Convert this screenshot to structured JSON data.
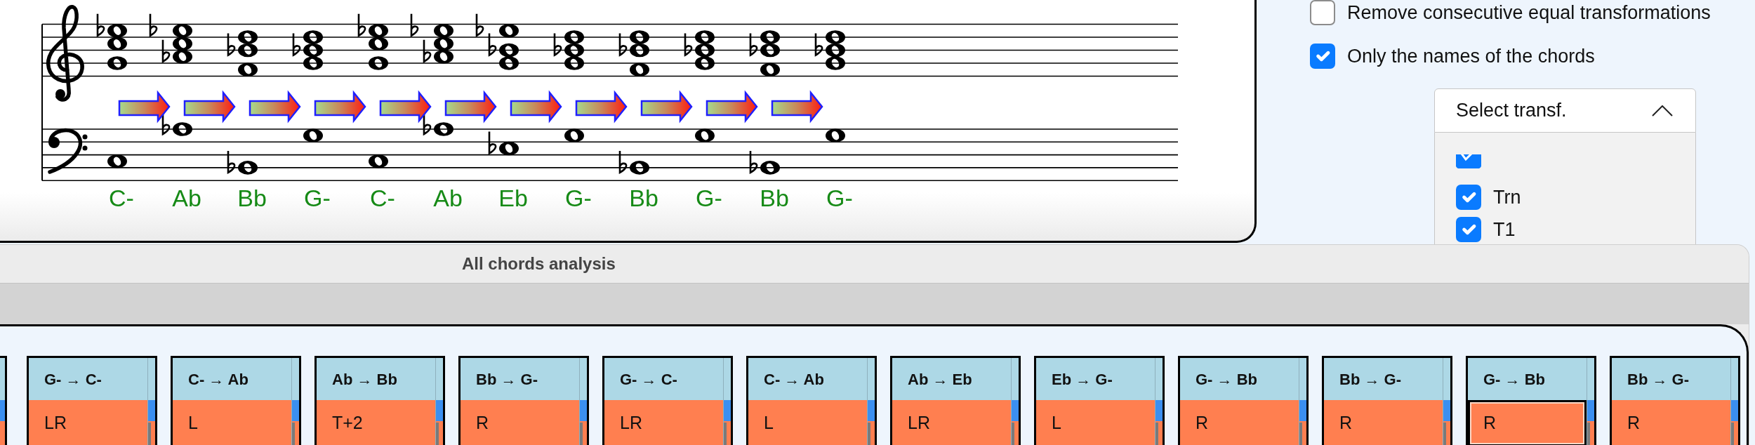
{
  "score": {
    "chords": [
      {
        "name": "C-"
      },
      {
        "name": "Ab"
      },
      {
        "name": "Bb"
      },
      {
        "name": "G-"
      },
      {
        "name": "C-"
      },
      {
        "name": "Ab"
      },
      {
        "name": "Eb"
      },
      {
        "name": "G-"
      },
      {
        "name": "Bb"
      },
      {
        "name": "G-"
      },
      {
        "name": "Bb"
      },
      {
        "name": "G-"
      }
    ]
  },
  "options": [
    {
      "label": "Remove consecutive equal transformations",
      "checked": false
    },
    {
      "label": "Only the names of the chords",
      "checked": true
    }
  ],
  "transform_select": {
    "label": "Select transf.",
    "expanded": true,
    "items": [
      {
        "checked": true
      },
      {
        "label": "Trn",
        "checked": true
      },
      {
        "label": "T1",
        "checked": true
      }
    ]
  },
  "analysis_window": {
    "title": "All chords analysis",
    "cards": [
      {
        "pair": "G- → C-",
        "transformation": "LR",
        "selected": false
      },
      {
        "pair": "C- → Ab",
        "transformation": "L",
        "selected": false
      },
      {
        "pair": "Ab → Bb",
        "transformation": "T+2",
        "selected": false
      },
      {
        "pair": "Bb → G-",
        "transformation": "R",
        "selected": false
      },
      {
        "pair": "G- → C-",
        "transformation": "LR",
        "selected": false
      },
      {
        "pair": "C- → Ab",
        "transformation": "L",
        "selected": false
      },
      {
        "pair": "Ab → Eb",
        "transformation": "LR",
        "selected": false
      },
      {
        "pair": "Eb → G-",
        "transformation": "L",
        "selected": false
      },
      {
        "pair": "G- → Bb",
        "transformation": "R",
        "selected": false
      },
      {
        "pair": "Bb → G-",
        "transformation": "R",
        "selected": false
      },
      {
        "pair": "G- → Bb",
        "transformation": "R",
        "selected": true
      },
      {
        "pair": "Bb → G-",
        "transformation": "R",
        "selected": false
      }
    ]
  }
}
